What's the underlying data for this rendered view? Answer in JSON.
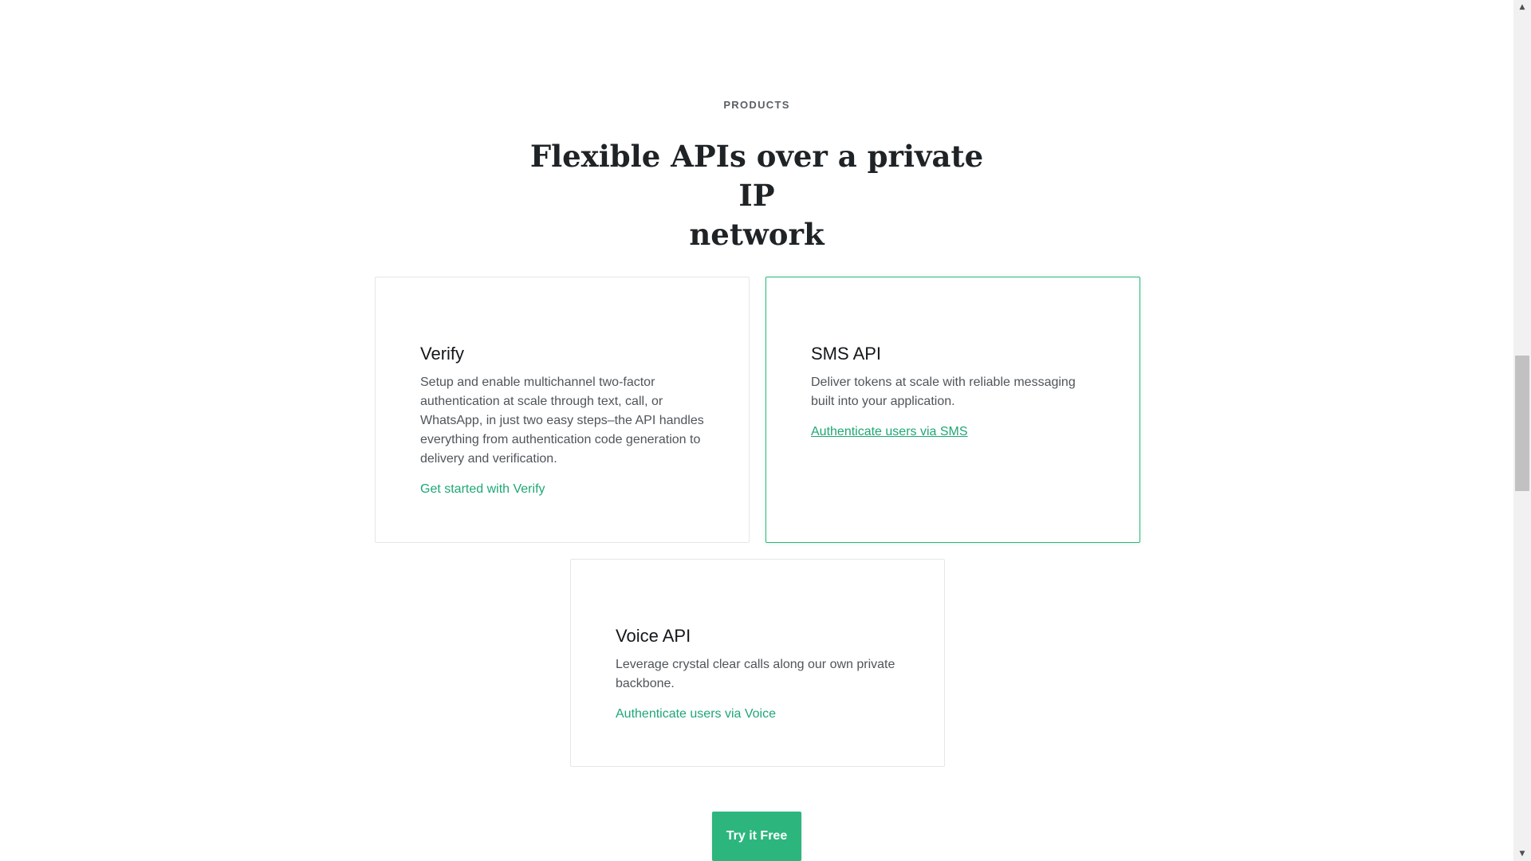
{
  "section": {
    "eyebrow": "PRODUCTS",
    "heading_line1": "Flexible APIs over a private IP",
    "heading_line2": "network"
  },
  "cards": [
    {
      "title": "Verify",
      "description": "Setup and enable multichannel two-factor authentication at scale through text, call, or WhatsApp, in just two easy steps–the API handles everything from authentication code generation to delivery and verification.",
      "link": "Get started with Verify"
    },
    {
      "title": "SMS API",
      "description": "Deliver tokens at scale with reliable messaging built into your application.",
      "link": "Authenticate users via SMS"
    },
    {
      "title": "Voice API",
      "description": "Leverage crystal clear calls along our own private backbone.",
      "link": "Authenticate users via Voice"
    }
  ],
  "cta": {
    "label": "Try it Free"
  },
  "colors": {
    "accent": "#2cb67d",
    "link": "#1fa774",
    "heading": "#1f2326",
    "body_text": "#4f555b",
    "card_border": "#e4e6e8"
  },
  "scrollbar": {
    "up_icon": "arrow-up-icon",
    "down_icon": "arrow-down-icon"
  }
}
